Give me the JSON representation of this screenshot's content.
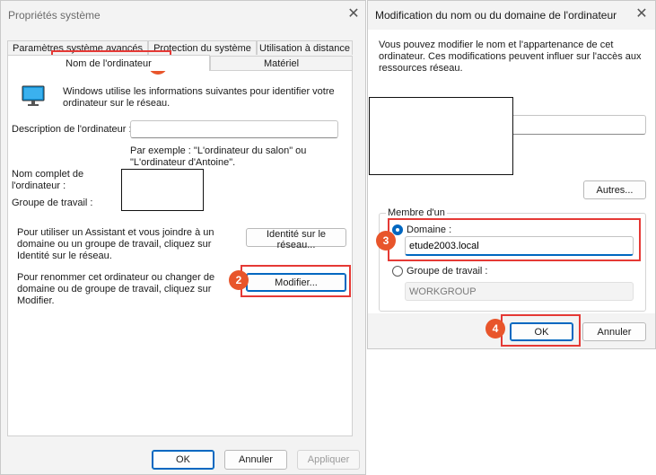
{
  "left_dialog": {
    "title": "Propriétés système",
    "tabs_row1": [
      "Paramètres système avancés",
      "Protection du système",
      "Utilisation à distance"
    ],
    "tabs_row2": [
      "Nom de l'ordinateur",
      "Matériel"
    ],
    "intro_text": "Windows utilise les informations suivantes pour identifier votre ordinateur sur le réseau.",
    "description_label": "Description de l'ordinateur :",
    "description_value": "",
    "example_text": "Par exemple : \"L'ordinateur du salon\" ou \"L'ordinateur d'Antoine\".",
    "full_name_label": "Nom complet de l'ordinateur :",
    "workgroup_label": "Groupe de travail :",
    "wizard_text": "Pour utiliser un Assistant et vous joindre à un domaine ou un groupe de travail, cliquez sur Identité sur le réseau.",
    "network_id_button": "Identité sur le réseau...",
    "rename_text": "Pour renommer cet ordinateur ou changer de domaine ou de groupe de travail, cliquez sur Modifier.",
    "modify_button": "Modifier...",
    "ok_button": "OK",
    "cancel_button": "Annuler",
    "apply_button": "Appliquer"
  },
  "right_dialog": {
    "title": "Modification du nom ou du domaine de l'ordinateur",
    "intro_text": "Vous pouvez modifier le nom et l'appartenance de cet ordinateur. Ces modifications peuvent influer sur l'accès aux ressources réseau.",
    "name_value": "",
    "more_button": "Autres...",
    "member_of_label": "Membre d'un",
    "domain_label": "Domaine :",
    "domain_value": "etude2003.local",
    "workgroup_label": "Groupe de travail :",
    "workgroup_value": "WORKGROUP",
    "ok_button": "OK",
    "cancel_button": "Annuler"
  },
  "badges": [
    "1",
    "2",
    "3",
    "4"
  ],
  "colors": {
    "accent": "#0067c0",
    "highlight": "#e53935",
    "badge": "#e8552b"
  },
  "icons": {
    "close": "close-icon",
    "computer": "monitor-icon"
  }
}
